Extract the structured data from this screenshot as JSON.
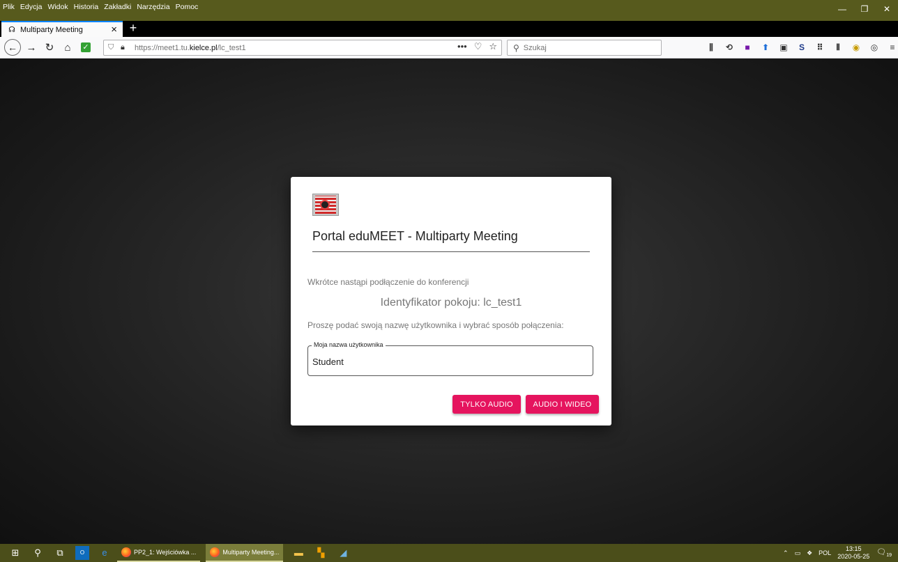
{
  "browser": {
    "menu": [
      "Plik",
      "Edycja",
      "Widok",
      "Historia",
      "Zakładki",
      "Narzędzia",
      "Pomoc"
    ],
    "window_controls": {
      "minimize": "—",
      "maximize": "❐",
      "close": "✕"
    },
    "tab": {
      "title": "Multiparty Meeting",
      "close": "×"
    },
    "new_tab": "+",
    "url_prefix": "https://meet1.tu.",
    "url_domain": "kielce.pl",
    "url_path": "/lc_test1",
    "search_placeholder": "Szukaj"
  },
  "dialog": {
    "title": "Portal eduMEET - Multiparty Meeting",
    "connecting_text": "Wkrótce nastąpi podłączenie do konferencji",
    "room_id": "Identyfikator pokoju: lc_test1",
    "instruction": "Proszę podać swoją nazwę użytkownika i wybrać sposób połączenia:",
    "username_label": "Moja nazwa użytkownika",
    "username_value": "Student",
    "audio_only_button": "TYLKO AUDIO",
    "audio_video_button": "AUDIO I WIDEO",
    "accent_color": "#e5145e"
  },
  "taskbar": {
    "apps": [
      "PP2_1: Wejściówka ...",
      "Multiparty Meeting..."
    ],
    "language": "POL",
    "time": "13:15",
    "date": "2020-05-25",
    "notifications": "19"
  }
}
